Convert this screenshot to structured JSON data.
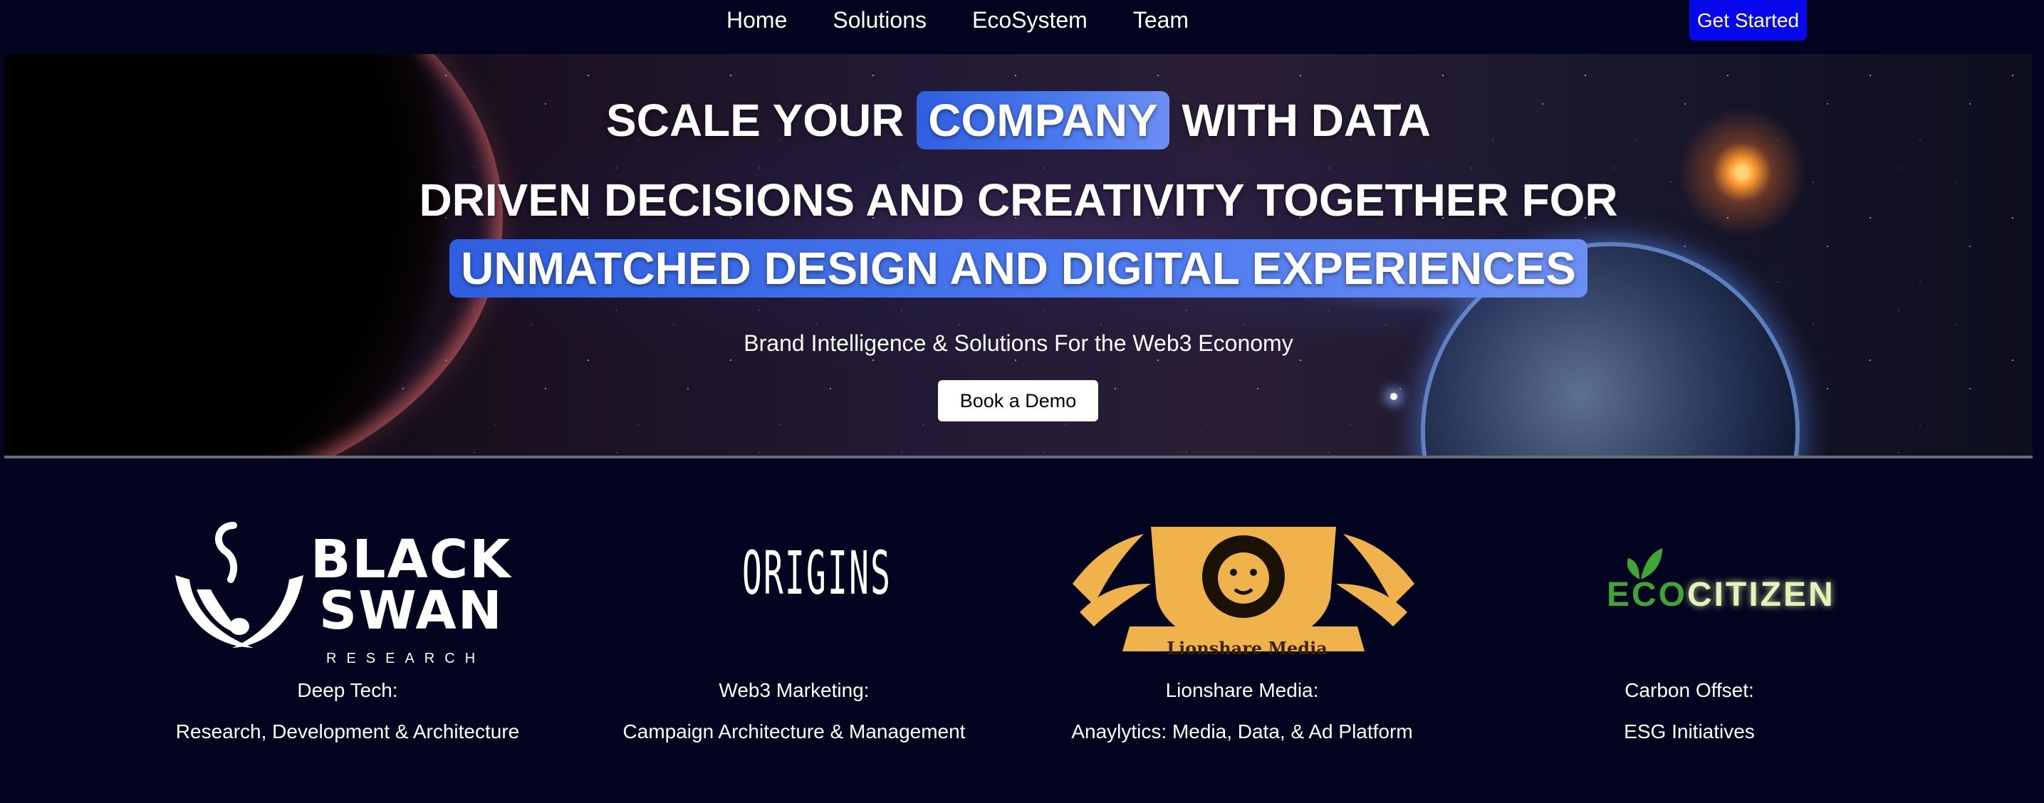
{
  "nav": {
    "links": [
      "Home",
      "Solutions",
      "EcoSystem",
      "Team"
    ],
    "cta_label": "Get Started"
  },
  "hero": {
    "line1_pre": "SCALE YOUR",
    "line1_highlight": "COMPANY",
    "line1_post": "WITH DATA",
    "line2": "DRIVEN DECISIONS AND CREATIVITY TOGETHER FOR",
    "line3_highlight": "UNMATCHED DESIGN AND DIGITAL EXPERIENCES",
    "subtitle": "Brand Intelligence & Solutions For the Web3 Economy",
    "demo_label": "Book a Demo"
  },
  "partners": [
    {
      "logo_text_1": "BLACK",
      "logo_text_2": "SWAN",
      "logo_sub": "RESEARCH",
      "name": "Deep Tech:",
      "desc": "Research, Development & Architecture"
    },
    {
      "logo_text": "ORIGINS",
      "name": "Web3 Marketing:",
      "desc": "Campaign Architecture & Management"
    },
    {
      "logo_text": "Lionshare Media",
      "name": "Lionshare Media:",
      "desc": "Anaylytics: Media, Data, & Ad Platform"
    },
    {
      "logo_text_green": "ECO",
      "logo_text_yellow": "CITIZEN",
      "name": "Carbon Offset:",
      "desc": "ESG Initiatives"
    }
  ],
  "colors": {
    "background": "#03041f",
    "cta": "#0707ec",
    "highlight": "#3b6ae8"
  }
}
